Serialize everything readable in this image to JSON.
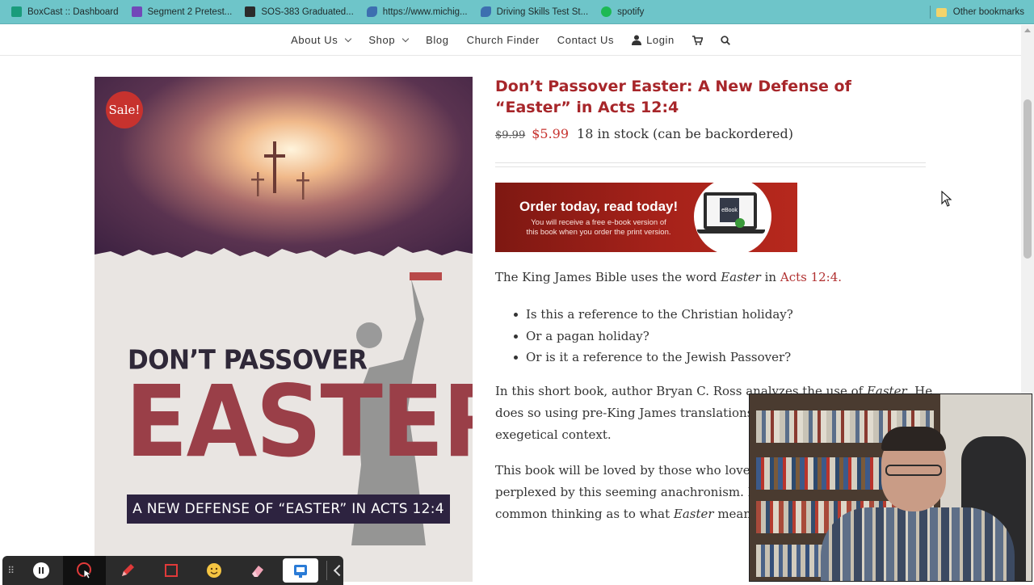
{
  "bookmarks": {
    "items": [
      {
        "label": "BoxCast :: Dashboard",
        "icon": "boxcast-icon",
        "color": "#1a9c7b"
      },
      {
        "label": "Segment 2 Pretest...",
        "icon": "forms-icon",
        "color": "#7248b9"
      },
      {
        "label": "SOS-383 Graduated...",
        "icon": "sos-icon",
        "color": "#2b2b2b"
      },
      {
        "label": "https://www.michig...",
        "icon": "michigan-icon",
        "color": "#3d6fb0"
      },
      {
        "label": "Driving Skills Test St...",
        "icon": "michigan-icon",
        "color": "#3d6fb0"
      },
      {
        "label": "spotify",
        "icon": "spotify-icon",
        "color": "#1db954"
      }
    ],
    "other": "Other bookmarks"
  },
  "nav": {
    "about": "About Us",
    "shop": "Shop",
    "blog": "Blog",
    "church_finder": "Church Finder",
    "contact": "Contact Us",
    "login": "Login"
  },
  "product": {
    "sale_badge": "Sale!",
    "cover_title_small": "DON’T PASSOVER",
    "cover_title_big": "EASTER",
    "cover_subtitle": "A NEW DEFENSE OF “EASTER” IN ACTS 12:4",
    "title": "Don’t Passover Easter: A New Defense of “Easter” in Acts 12:4",
    "old_price": "$9.99",
    "new_price": "$5.99",
    "stock": "18 in stock (can be backordered)",
    "banner_heading": "Order today, read today!",
    "banner_sub": "You will receive a free e-book version of this book when you order the print version.",
    "banner_ebook": "eBook"
  },
  "description": {
    "p1_a": "The King James Bible uses the word ",
    "p1_em": "Easter",
    "p1_b": " in ",
    "p1_link": "Acts 12:4",
    "p1_c": ".",
    "bullets": [
      "Is this a reference to the Christian holiday?",
      "Or a pagan holiday?",
      "Or is it a reference to the Jewish Passover?"
    ],
    "p2_line1_a": "In this short book, author Bryan C. Ross analyzes the use of ",
    "p2_line1_em": "Easter",
    "p2_line1_b": ". He",
    "p2_line2": "does so using pre-King James translations,",
    "p2_line3": "exegetical context.",
    "p3_line1": "This book will be loved by those who love th",
    "p3_line2": "perplexed by this seeming anachronism. It",
    "p3_line3_a": "common thinking as to what ",
    "p3_line3_em": "Easter",
    "p3_line3_b": " means"
  },
  "colors": {
    "accent": "#a7262a",
    "sale": "#c7322e",
    "bookmark_bar": "#6ec5c9"
  }
}
